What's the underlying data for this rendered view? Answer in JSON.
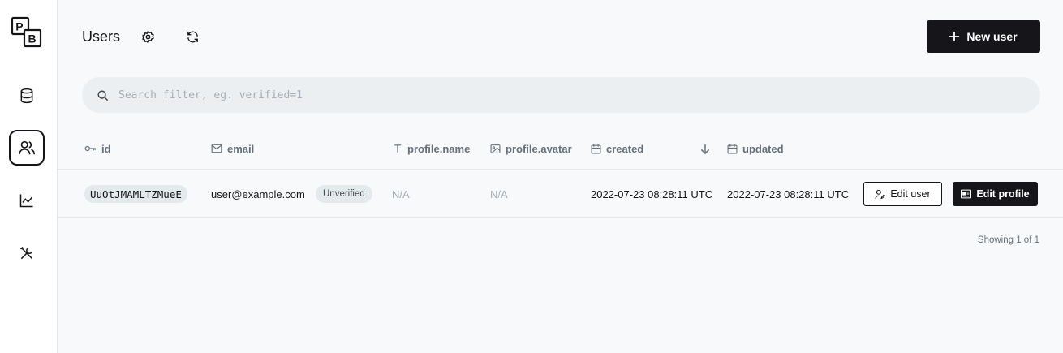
{
  "sidebar": {
    "logo_letters": [
      "P",
      "B"
    ],
    "items": [
      {
        "name": "collections",
        "icon": "database-icon",
        "active": false
      },
      {
        "name": "users",
        "icon": "users-icon",
        "active": true
      },
      {
        "name": "logs",
        "icon": "line-chart-icon",
        "active": false
      },
      {
        "name": "settings",
        "icon": "tools-icon",
        "active": false
      }
    ]
  },
  "header": {
    "title": "Users",
    "settings_icon": "gear-icon",
    "refresh_icon": "refresh-icon",
    "new_user_label": "New user"
  },
  "search": {
    "placeholder": "Search filter, eg. verified=1",
    "value": ""
  },
  "table": {
    "columns": [
      {
        "label": "id",
        "icon": "key-icon"
      },
      {
        "label": "email",
        "icon": "mail-icon"
      },
      {
        "label": "profile.name",
        "icon": "text-icon"
      },
      {
        "label": "profile.avatar",
        "icon": "image-icon"
      },
      {
        "label": "created",
        "icon": "calendar-icon",
        "sort_icon": "arrow-down-icon"
      },
      {
        "label": "updated",
        "icon": "calendar-icon"
      }
    ],
    "rows": [
      {
        "id": "UuOtJMAMLTZMueE",
        "email": "user@example.com",
        "status_badge": "Unverified",
        "profile_name": "N/A",
        "profile_avatar": "N/A",
        "created": "2022-07-23 08:28:11 UTC",
        "updated": "2022-07-23 08:28:11 UTC",
        "edit_user_label": "Edit user",
        "edit_profile_label": "Edit profile"
      }
    ],
    "showing": "Showing 1 of 1"
  },
  "colors": {
    "accent": "#16161a",
    "background": "#f8f9fa",
    "border": "#e4e9ec",
    "muted_text": "#66707a"
  }
}
